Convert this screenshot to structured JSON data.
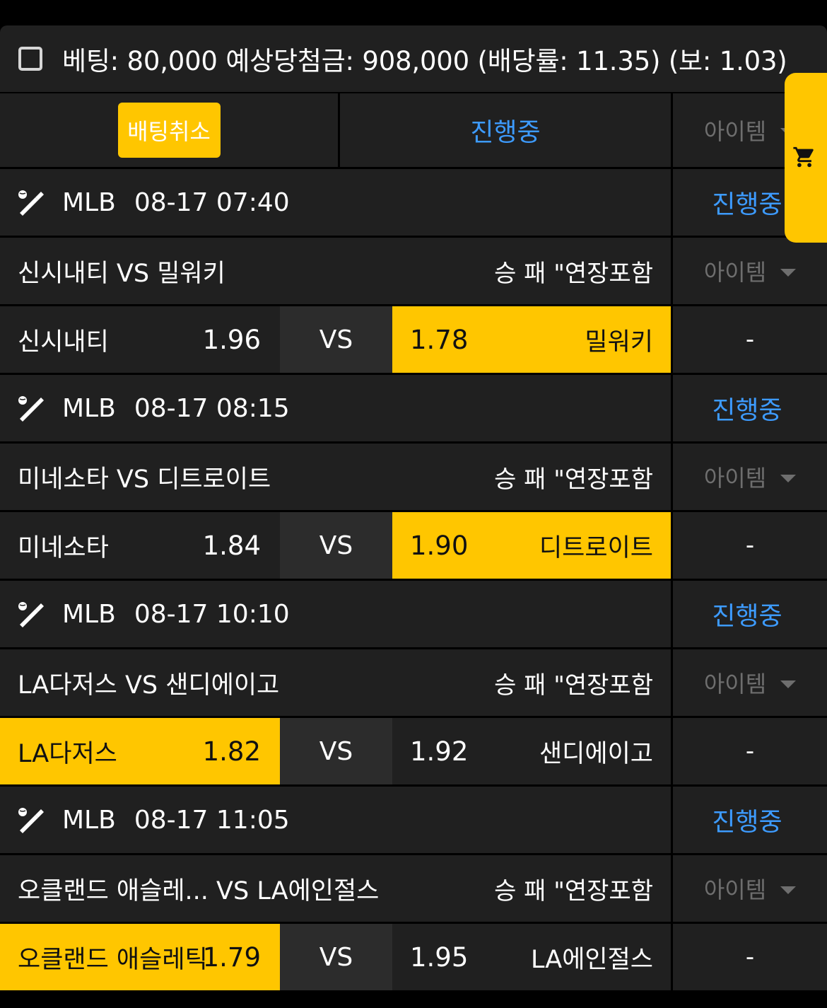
{
  "summary": {
    "text": "베팅: 80,000 예상당첨금: 908,000 (배당률: 11.35) (보: 1.03)"
  },
  "toolbar": {
    "cancel_label": "배팅취소",
    "status_label": "진행중",
    "item_label": "아이템"
  },
  "games": [
    {
      "league": "MLB",
      "time": "08-17 07:40",
      "status": "진행중",
      "title": "신시내티 VS 밀워키",
      "market": "승 패 \"연장포함",
      "item_label": "아이템",
      "home": {
        "name": "신시내티",
        "odds": "1.96",
        "selected": false
      },
      "vs": "VS",
      "away": {
        "name": "밀워키",
        "odds": "1.78",
        "selected": true
      },
      "extra": "-"
    },
    {
      "league": "MLB",
      "time": "08-17 08:15",
      "status": "진행중",
      "title": "미네소타 VS 디트로이트",
      "market": "승 패 \"연장포함",
      "item_label": "아이템",
      "home": {
        "name": "미네소타",
        "odds": "1.84",
        "selected": false
      },
      "vs": "VS",
      "away": {
        "name": "디트로이트",
        "odds": "1.90",
        "selected": true
      },
      "extra": "-"
    },
    {
      "league": "MLB",
      "time": "08-17 10:10",
      "status": "진행중",
      "title": "LA다저스 VS 샌디에이고",
      "market": "승 패 \"연장포함",
      "item_label": "아이템",
      "home": {
        "name": "LA다저스",
        "odds": "1.82",
        "selected": true
      },
      "vs": "VS",
      "away": {
        "name": "샌디에이고",
        "odds": "1.92",
        "selected": false
      },
      "extra": "-"
    },
    {
      "league": "MLB",
      "time": "08-17 11:05",
      "status": "진행중",
      "title": "오클랜드 애슬레...    VS LA에인절스",
      "market": "승 패 \"연장포함",
      "item_label": "아이템",
      "home": {
        "name": "오클랜드 애슬레틱",
        "odds": "1.79",
        "selected": true
      },
      "vs": "VS",
      "away": {
        "name": "LA에인절스",
        "odds": "1.95",
        "selected": false
      },
      "extra": "-"
    }
  ],
  "icons": {
    "sport": "baseball-bat-icon",
    "cart": "cart-icon",
    "checkbox": "checkbox-icon"
  },
  "colors": {
    "accent": "#ffc600",
    "link": "#3d9bff",
    "background": "#202020"
  }
}
